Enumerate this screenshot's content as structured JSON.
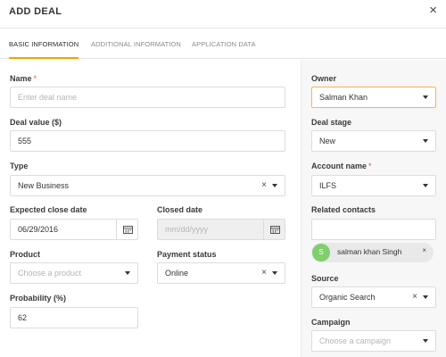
{
  "header": {
    "title": "ADD DEAL",
    "close_icon": "×"
  },
  "tabs": [
    {
      "label": "BASIC INFORMATION",
      "active": true
    },
    {
      "label": "ADDITIONAL INFORMATION",
      "active": false
    },
    {
      "label": "APPLICATION DATA",
      "active": false
    }
  ],
  "colors": {
    "accent": "#f0a500",
    "required": "#e5533d",
    "avatar": "#7fcf6f"
  },
  "form": {
    "name": {
      "label": "Name",
      "required": "*",
      "placeholder": "Enter deal name"
    },
    "deal_value": {
      "label": "Deal value ($)",
      "value": "555"
    },
    "type": {
      "label": "Type",
      "value": "New Business",
      "clear": "×"
    },
    "expected_close_date": {
      "label": "Expected close date",
      "value": "06/29/2016"
    },
    "closed_date": {
      "label": "Closed date",
      "placeholder": "mm/dd/yyyy"
    },
    "product": {
      "label": "Product",
      "placeholder": "Choose a product"
    },
    "payment_status": {
      "label": "Payment status",
      "value": "Online",
      "clear": "×"
    },
    "probability": {
      "label": "Probability (%)",
      "value": "62"
    }
  },
  "side": {
    "owner": {
      "label": "Owner",
      "value": "Salman Khan"
    },
    "deal_stage": {
      "label": "Deal stage",
      "value": "New"
    },
    "account_name": {
      "label": "Account name",
      "required": "*",
      "value": "ILFS"
    },
    "related_contacts": {
      "label": "Related contacts",
      "chip": {
        "initial": "S",
        "name": "salman khan Singh",
        "remove": "×"
      }
    },
    "source": {
      "label": "Source",
      "value": "Organic Search",
      "clear": "×"
    },
    "campaign": {
      "label": "Campaign",
      "placeholder": "Choose a campaign"
    }
  }
}
